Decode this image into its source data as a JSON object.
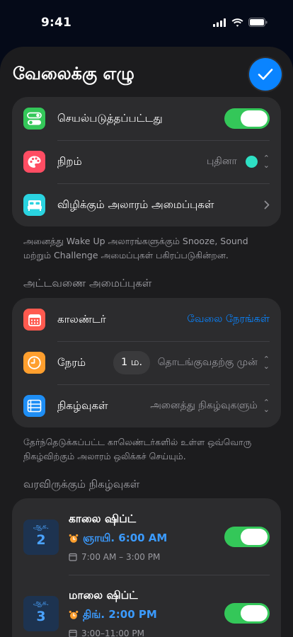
{
  "status_bar": {
    "time": "9:41"
  },
  "header": {
    "title": "வேலைக்கு எழு"
  },
  "settings": {
    "enabled_label": "செயல்படுத்தப்பட்டது",
    "enabled": true,
    "color_label": "நிறம்",
    "color_value": "புதினா",
    "color_swatch": "#2ee0c4",
    "wake_alarm_label": "விழிக்கும் அலாரம் அமைப்புகள்"
  },
  "settings_note": "அனைத்து Wake Up அலாரங்களுக்கும் Snooze, Sound மற்றும் Challenge அமைப்புகள் பகிரப்படுகின்றன.",
  "schedule": {
    "section_title": "அட்டவணை அமைப்புகள்",
    "calendar_label": "காலண்டர்",
    "calendar_value": "வேலை நேரங்கள்",
    "time_label": "நேரம்",
    "time_offset": "1 ம.",
    "time_value": "தொடங்குவதற்கு முன்",
    "events_label": "நிகழ்வுகள்",
    "events_value": "அனைத்து நிகழ்வுகளும்"
  },
  "schedule_note": "தேர்ந்தெடுக்கப்பட்ட காலெண்டர்களில் உள்ள ஒவ்வொரு நிகழ்விற்கும் அலாரம் ஒலிக்கச் செய்யும்.",
  "upcoming": {
    "section_title": "வரவிருக்கும் நிகழ்வுகள்",
    "events": [
      {
        "month": "ஆக.",
        "day": "2",
        "name": "காலை ஷிப்ட்",
        "alarm": "ஞாயி. 6:00 AM",
        "time_range": "7:00 AM – 3:00 PM",
        "enabled": true
      },
      {
        "month": "ஆக.",
        "day": "3",
        "name": "மாலை ஷிப்ட்",
        "alarm": "திங். 2:00 PM",
        "time_range": "3:00–11:00 PM",
        "enabled": true
      }
    ]
  },
  "colors": {
    "accent": "#0a84ff",
    "toggle_on": "#34c759"
  }
}
